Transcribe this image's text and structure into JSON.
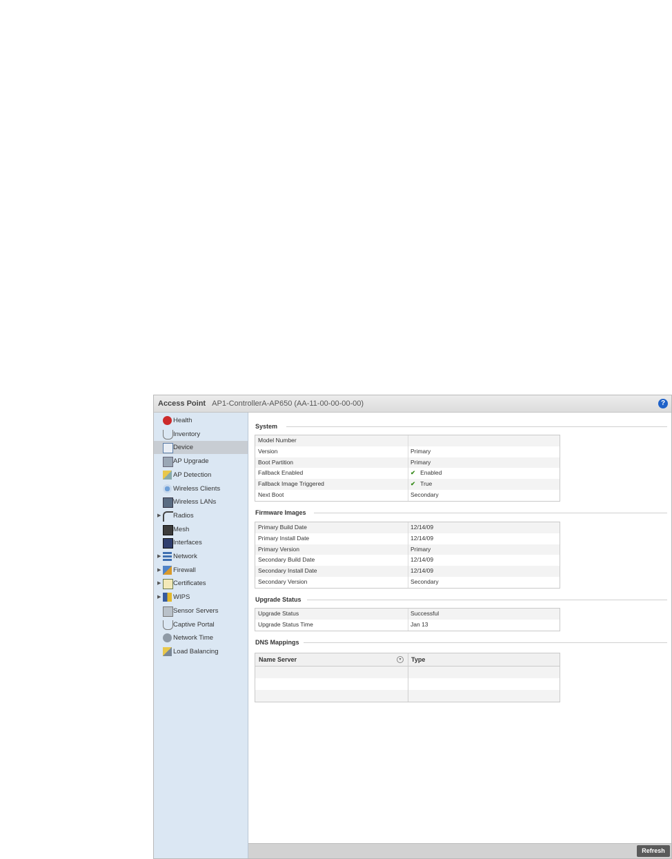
{
  "title": {
    "label": "Access Point",
    "device": "AP1-ControllerA-AP650 (AA-11-00-00-00-00)",
    "help": "?"
  },
  "sidebar": {
    "items": [
      {
        "label": "Health",
        "icon": "health-icon",
        "expandable": false,
        "selected": false
      },
      {
        "label": "Inventory",
        "icon": "inventory-icon",
        "expandable": false,
        "selected": false
      },
      {
        "label": "Device",
        "icon": "device-icon",
        "expandable": false,
        "selected": true
      },
      {
        "label": "AP Upgrade",
        "icon": "ap-upgrade-icon",
        "expandable": false,
        "selected": false
      },
      {
        "label": "AP Detection",
        "icon": "ap-detection-icon",
        "expandable": false,
        "selected": false
      },
      {
        "label": "Wireless Clients",
        "icon": "wireless-clients-icon",
        "expandable": false,
        "selected": false
      },
      {
        "label": "Wireless LANs",
        "icon": "wireless-lans-icon",
        "expandable": false,
        "selected": false
      },
      {
        "label": "Radios",
        "icon": "radios-icon",
        "expandable": true,
        "selected": false
      },
      {
        "label": "Mesh",
        "icon": "mesh-icon",
        "expandable": false,
        "selected": false
      },
      {
        "label": "Interfaces",
        "icon": "interfaces-icon",
        "expandable": false,
        "selected": false
      },
      {
        "label": "Network",
        "icon": "network-icon",
        "expandable": true,
        "selected": false
      },
      {
        "label": "Firewall",
        "icon": "firewall-icon",
        "expandable": true,
        "selected": false
      },
      {
        "label": "Certificates",
        "icon": "certificates-icon",
        "expandable": true,
        "selected": false
      },
      {
        "label": "WIPS",
        "icon": "wips-icon",
        "expandable": true,
        "selected": false
      },
      {
        "label": "Sensor Servers",
        "icon": "sensor-servers-icon",
        "expandable": false,
        "selected": false
      },
      {
        "label": "Captive Portal",
        "icon": "captive-portal-icon",
        "expandable": false,
        "selected": false
      },
      {
        "label": "Network Time",
        "icon": "network-time-icon",
        "expandable": false,
        "selected": false
      },
      {
        "label": "Load Balancing",
        "icon": "load-balancing-icon",
        "expandable": false,
        "selected": false
      }
    ]
  },
  "system": {
    "title": "System",
    "rows": [
      {
        "key": "Model Number",
        "value": "",
        "check": false
      },
      {
        "key": "Version",
        "value": "Primary",
        "check": false
      },
      {
        "key": "Boot Partition",
        "value": "Primary",
        "check": false
      },
      {
        "key": "Fallback Enabled",
        "value": "Enabled",
        "check": true
      },
      {
        "key": "Fallback Image Triggered",
        "value": "True",
        "check": true
      },
      {
        "key": "Next Boot",
        "value": "Secondary",
        "check": false
      }
    ]
  },
  "firmware": {
    "title": "Firmware Images",
    "rows": [
      {
        "key": "Primary Build Date",
        "value": "12/14/09"
      },
      {
        "key": "Primary Install Date",
        "value": "12/14/09"
      },
      {
        "key": "Primary Version",
        "value": "Primary"
      },
      {
        "key": "Secondary Build Date",
        "value": "12/14/09"
      },
      {
        "key": "Secondary Install Date",
        "value": "12/14/09"
      },
      {
        "key": "Secondary Version",
        "value": "Secondary"
      }
    ]
  },
  "upgrade": {
    "title": "Upgrade Status",
    "rows": [
      {
        "key": "Upgrade Status",
        "value": "Successful"
      },
      {
        "key": "Upgrade Status Time",
        "value": "Jan 13"
      }
    ]
  },
  "dns": {
    "title": "DNS Mappings",
    "col_name_server": "Name Server",
    "col_type": "Type",
    "rows": []
  },
  "footer": {
    "refresh_label": "Refresh"
  },
  "colors": {
    "accent": "#1f62c9",
    "sidebar_bg": "#dbe7f3",
    "selected_bg": "#c8cdd3",
    "check": "#3a8d1e"
  }
}
